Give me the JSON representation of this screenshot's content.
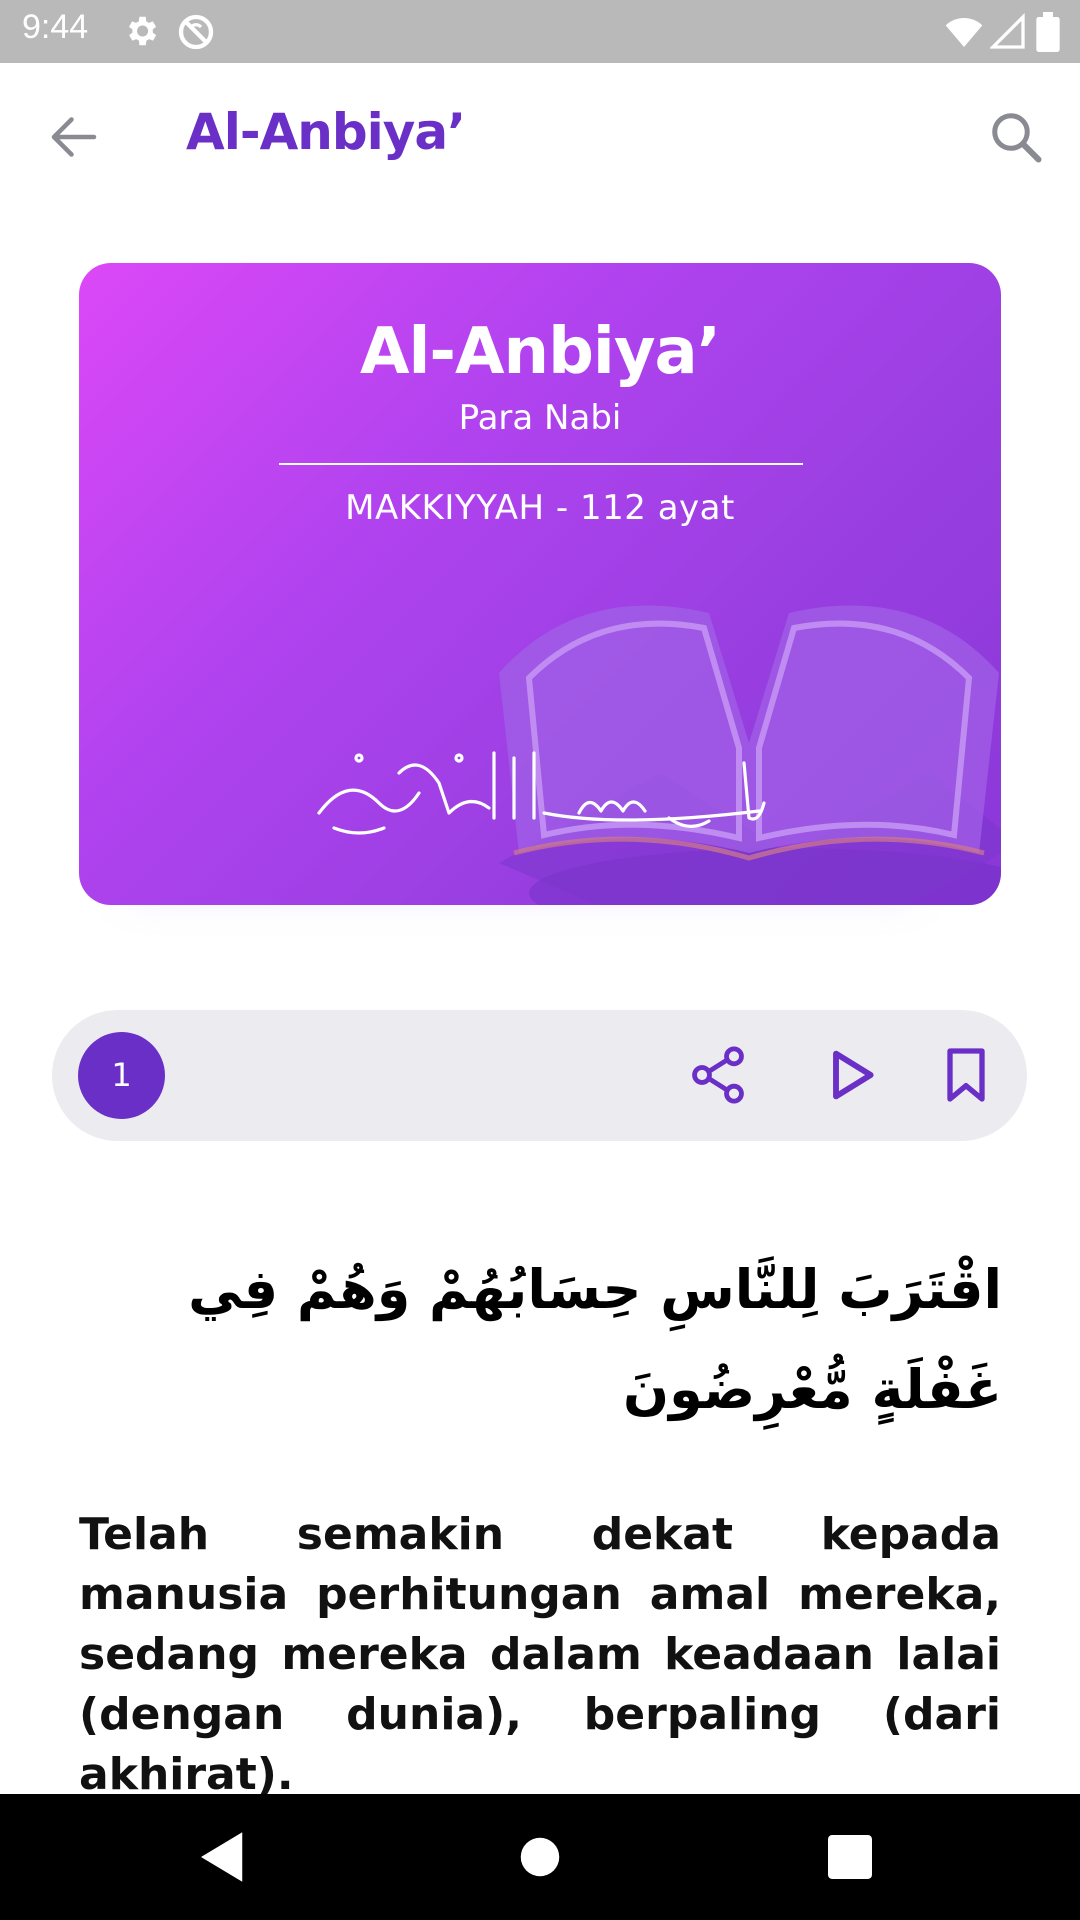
{
  "status_bar": {
    "time": "9:44",
    "icons": [
      "gear-icon",
      "sync-off-icon",
      "wifi-icon",
      "signal-icon",
      "battery-icon"
    ]
  },
  "app_bar": {
    "title": "Al-Anbiya’",
    "back_icon": "arrow-left-icon",
    "search_icon": "search-icon"
  },
  "surah_card": {
    "title": "Al-Anbiya’",
    "subtitle": "Para Nabi",
    "info": "MAKKIYYAH - 112 ayat",
    "gradient_start": "#dc48f7",
    "gradient_end": "#8a37d8"
  },
  "ayah_toolbar": {
    "number": "1",
    "actions": [
      "share-icon",
      "play-icon",
      "bookmark-icon"
    ],
    "accent": "#6a2fc7"
  },
  "ayah": {
    "arabic": "اقْتَرَبَ لِلنَّاسِ حِسَابُهُمْ وَهُمْ فِي غَفْلَةٍ مُّعْرِضُونَ",
    "translation": "Telah semakin dekat kepada manusia perhitungan amal mereka, sedang mereka dalam keadaan lalai (dengan dunia), berpaling (dari akhirat)."
  },
  "nav_bar": {
    "buttons": [
      "back-triangle-icon",
      "home-circle-icon",
      "recents-square-icon"
    ]
  }
}
